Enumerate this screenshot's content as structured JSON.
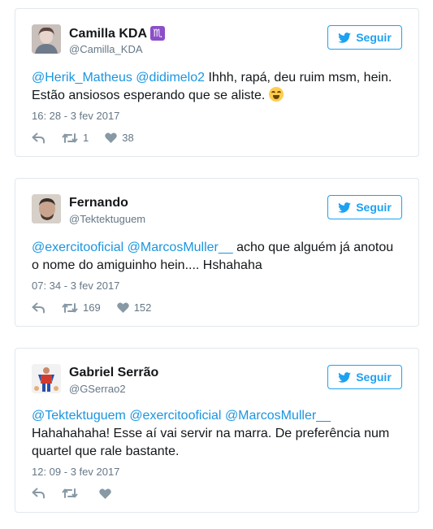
{
  "colors": {
    "link": "#1b95e0",
    "twitter_blue": "#1da1f2",
    "secondary_text": "#657786",
    "border": "#e1e8ed",
    "zodiac_badge": "#8b4fc8"
  },
  "tweets": [
    {
      "name": "Camilla KDA",
      "badge": "♏",
      "handle": "@Camilla_KDA",
      "follow_label": "Seguir",
      "mentions": [
        "@Herik_Matheus",
        "@didimelo2"
      ],
      "text_line": " Ihhh, rapá, deu ruim msm, hein. Estão ansiosos esperando que se aliste.",
      "emoji": "face-with-tears-of-joy",
      "timestamp": "16: 28 - 3 fev 2017",
      "retweets": "1",
      "likes": "38"
    },
    {
      "name": "Fernando",
      "handle": "@Tektektuguem",
      "follow_label": "Seguir",
      "mentions": [
        "@exercitooficial",
        "@MarcosMuller__"
      ],
      "text_line": " acho que alguém já anotou o nome do amiguinho hein.... Hshahaha",
      "timestamp": "07: 34 - 3 fev 2017",
      "retweets": "169",
      "likes": "152"
    },
    {
      "name": "Gabriel Serrão",
      "handle": "@GSerrao2",
      "follow_label": "Seguir",
      "mentions": [
        "@Tektektuguem",
        "@exercitooficial",
        "@MarcosMuller__"
      ],
      "text_line": "Hahahahaha! Esse aí vai servir na marra. De preferência num quartel que rale bastante.",
      "timestamp": "12: 09 - 3 fev 2017",
      "retweets": "",
      "likes": ""
    }
  ],
  "icons": {
    "reply": "reply-icon",
    "retweet": "retweet-icon",
    "like": "heart-icon",
    "follow_bird": "twitter-bird-icon"
  }
}
